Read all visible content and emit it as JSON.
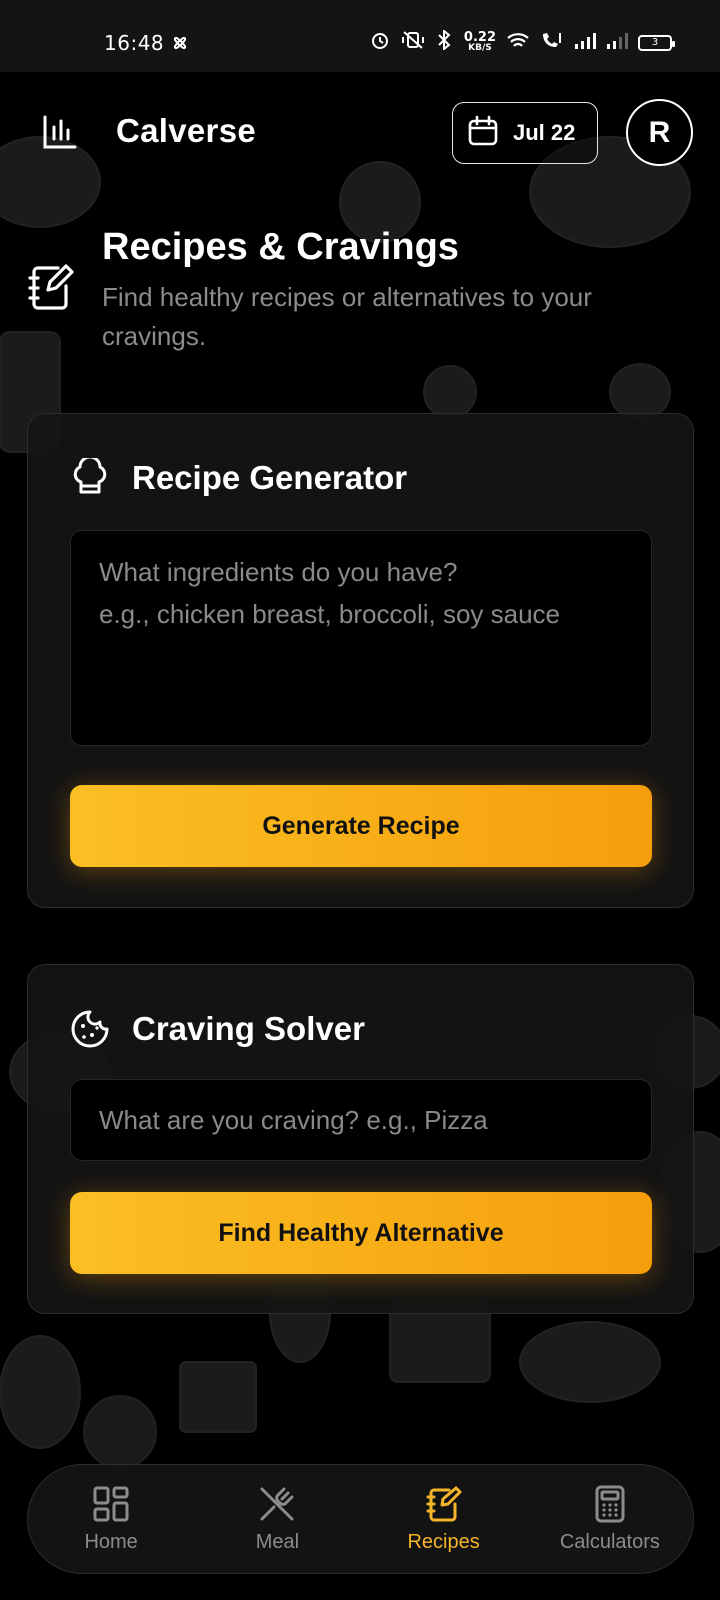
{
  "status_bar": {
    "time": "16:48",
    "net_speed_value": "0.22",
    "net_speed_unit": "KB/S",
    "battery": "3"
  },
  "header": {
    "app_title": "Calverse",
    "date_label": "Jul 22",
    "avatar_initial": "R"
  },
  "page": {
    "title": "Recipes & Cravings",
    "subtitle": "Find healthy recipes or alternatives to your cravings."
  },
  "recipe_generator": {
    "title": "Recipe Generator",
    "textarea_placeholder": "What ingredients do you have?\ne.g., chicken breast, broccoli, soy sauce",
    "button_label": "Generate Recipe"
  },
  "craving_solver": {
    "title": "Craving Solver",
    "input_placeholder": "What are you craving? e.g., Pizza",
    "button_label": "Find Healthy Alternative"
  },
  "bottom_nav": {
    "items": [
      {
        "label": "Home",
        "icon": "grid-icon",
        "active": false
      },
      {
        "label": "Meal",
        "icon": "utensils-icon",
        "active": false
      },
      {
        "label": "Recipes",
        "icon": "notebook-pen-icon",
        "active": true
      },
      {
        "label": "Calculators",
        "icon": "calculator-icon",
        "active": false
      }
    ]
  },
  "colors": {
    "background": "#000000",
    "accent": "#f5b52a",
    "button_gradient_start": "#fbbf24",
    "button_gradient_end": "#f59e0b",
    "card": "#141414",
    "muted_text": "#8b8b8b"
  }
}
